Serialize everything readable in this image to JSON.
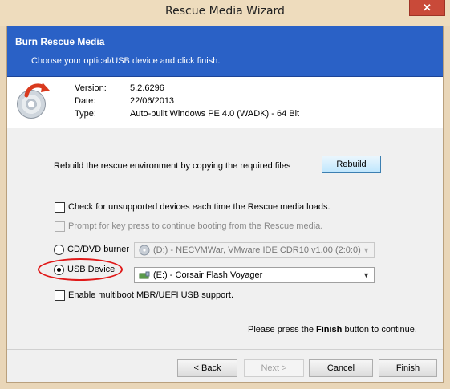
{
  "window": {
    "title": "Rescue Media Wizard",
    "close_label": "✕"
  },
  "banner": {
    "title": "Burn Rescue Media",
    "subtitle": "Choose your optical/USB device and click finish."
  },
  "info": {
    "version_label": "Version:",
    "version_value": "5.2.6296",
    "date_label": "Date:",
    "date_value": "22/06/2013",
    "type_label": "Type:",
    "type_value": "Auto-built Windows PE 4.0 (WADK) - 64 Bit"
  },
  "rebuild": {
    "text": "Rebuild the rescue environment by copying the required files",
    "button_label": "Rebuild"
  },
  "options": {
    "check_unsupported": {
      "label": "Check for unsupported devices each time the Rescue media loads.",
      "checked": false
    },
    "prompt_keypress": {
      "label": "Prompt for key press to continue booting from the Rescue media.",
      "checked": false,
      "disabled": true
    },
    "multiboot": {
      "label": "Enable multiboot MBR/UEFI USB support.",
      "checked": false
    }
  },
  "devices": {
    "cd_label": "CD/DVD burner",
    "cd_selected": false,
    "cd_value": "(D:) - NECVMWar, VMware IDE CDR10 v1.00 (2:0:0)",
    "usb_label": "USB Device",
    "usb_selected": true,
    "usb_value": "(E:) - Corsair Flash Voyager"
  },
  "continue_text": {
    "before": "Please press the ",
    "bold": "Finish",
    "after": " button to continue."
  },
  "footer": {
    "back_label": "< Back",
    "next_label": "Next >",
    "cancel_label": "Cancel",
    "finish_label": "Finish"
  },
  "colors": {
    "banner": "#2a61c6",
    "highlight": "#e01919"
  }
}
